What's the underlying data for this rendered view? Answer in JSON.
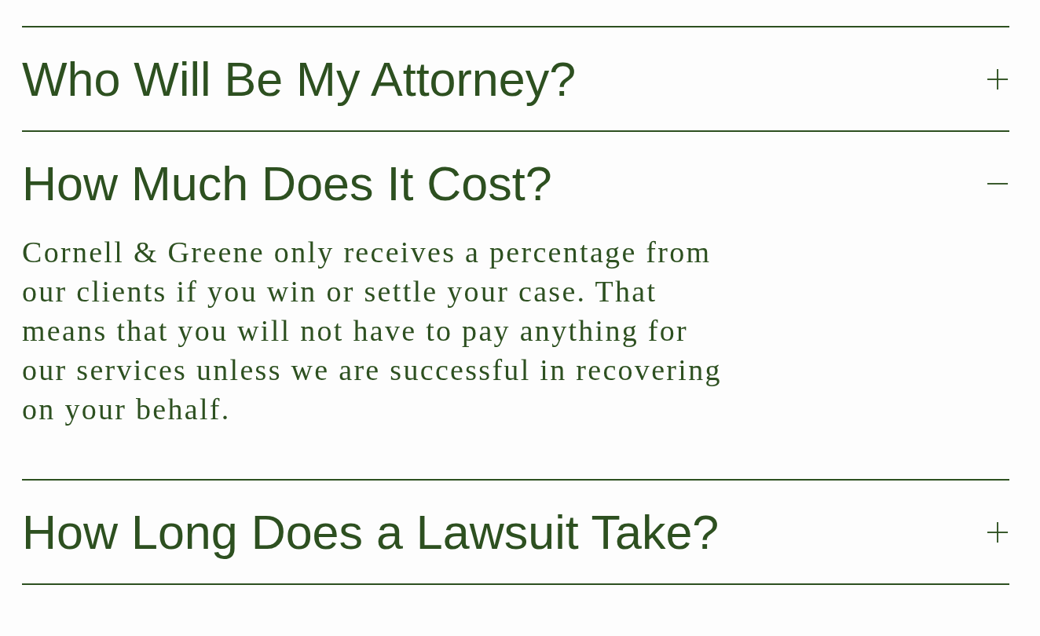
{
  "faq": [
    {
      "question": "Who Will Be My Attorney?",
      "expanded": false
    },
    {
      "question": "How Much Does It Cost?",
      "expanded": true,
      "answer": "Cornell & Greene only receives a percentage from our clients if you win or settle your case. That means that you will not have to pay anything for our services unless we are successful in recovering on your behalf."
    },
    {
      "question": "How Long Does a Lawsuit Take?",
      "expanded": false
    }
  ]
}
